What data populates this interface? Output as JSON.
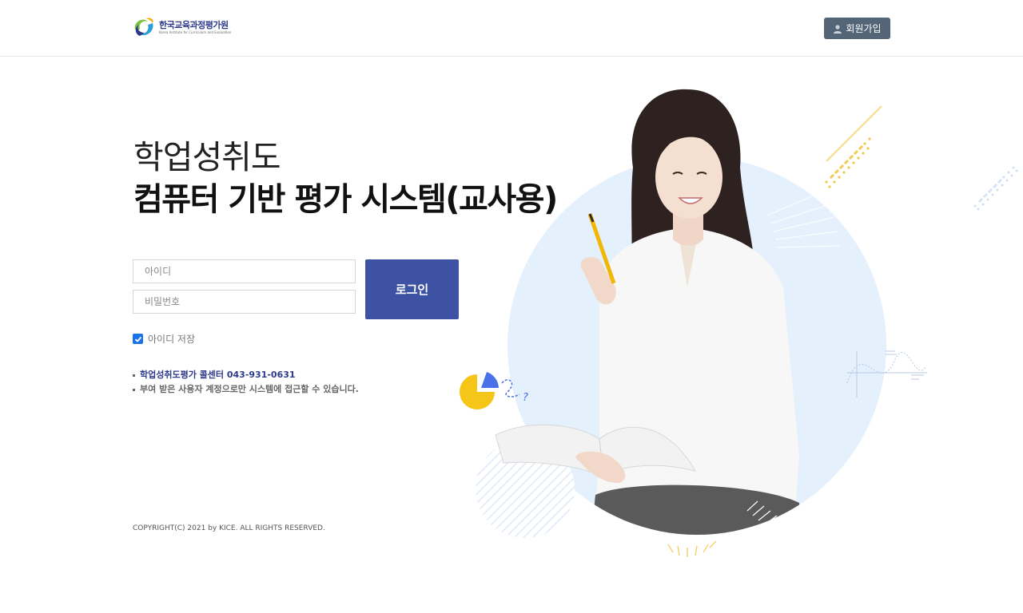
{
  "header": {
    "logo_text": "한국교육과정평가원",
    "logo_subtext": "Korea Institute for Curriculum and Evaluation",
    "join_label": "회원가입"
  },
  "main": {
    "title_line1": "학업성취도",
    "title_line2": "컴퓨터 기반 평가 시스템(교사용)"
  },
  "login": {
    "id_placeholder": "아이디",
    "password_placeholder": "비밀번호",
    "button_label": "로그인",
    "save_id_label": "아이디 저장",
    "save_id_checked": true
  },
  "notes": {
    "call_center": "학업성취도평가 콜센터 043-931-0631",
    "account_notice": "부여 받은 사용자 계정으로만 시스템에 접근할 수 있습니다."
  },
  "footer": {
    "copyright": "COPYRIGHT(C) 2021 by KICE. ALL RIGHTS RESERVED."
  },
  "colors": {
    "accent": "#3e52a3",
    "join_button": "#546577",
    "circle": "#e4f0fc",
    "pie_yellow": "#f5c518",
    "pie_blue": "#4a72e8"
  }
}
